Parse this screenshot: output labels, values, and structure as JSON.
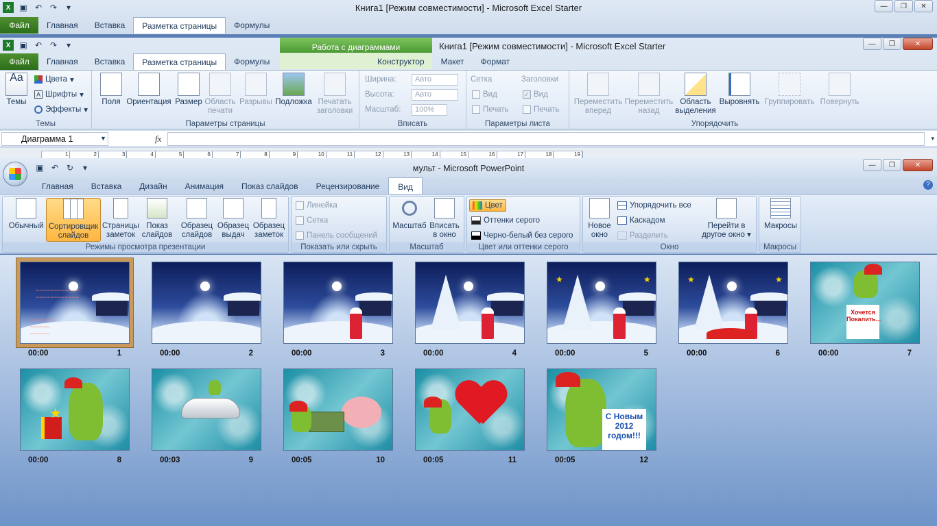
{
  "excel_bg": {
    "title": "Книга1  [Режим совместимости]  -  Microsoft Excel Starter",
    "tabs": [
      "Файл",
      "Главная",
      "Вставка",
      "Разметка страницы",
      "Формулы"
    ]
  },
  "excel": {
    "title": "Книга1  [Режим совместимости]  -  Microsoft Excel Starter",
    "chart_tools": "Работа с диаграммами",
    "tabs": [
      "Файл",
      "Главная",
      "Вставка",
      "Разметка страницы",
      "Формулы",
      "Конструктор",
      "Макет",
      "Формат"
    ],
    "ribbon": {
      "themes": {
        "label": "Темы",
        "btn": "Темы",
        "colors": "Цвета",
        "fonts": "Шрифты",
        "effects": "Эффекты"
      },
      "page_setup": {
        "label": "Параметры страницы",
        "margins": "Поля",
        "orientation": "Ориентация",
        "size": "Размер",
        "print_area_1": "Область",
        "print_area_2": "печати",
        "breaks": "Разрывы",
        "background": "Подложка",
        "print_titles_1": "Печатать",
        "print_titles_2": "заголовки"
      },
      "fit": {
        "label": "Вписать",
        "width": "Ширина:",
        "height": "Высота:",
        "scale": "Масштаб:",
        "width_val": "Авто",
        "height_val": "Авто",
        "scale_val": "100%"
      },
      "sheet": {
        "label": "Параметры листа",
        "grid": "Сетка",
        "headings": "Заголовки",
        "view": "Вид",
        "print": "Печать"
      },
      "arrange": {
        "label": "Упорядочить",
        "fwd_1": "Переместить",
        "fwd_2": "вперед",
        "back_1": "Переместить",
        "back_2": "назад",
        "sel_1": "Область",
        "sel_2": "выделения",
        "align": "Выровнять",
        "group": "Группировать",
        "rotate": "Повернуть"
      }
    },
    "name_box": "Диаграмма 1",
    "fx": "fx",
    "ruler_numbers": [
      "1",
      "2",
      "3",
      "4",
      "5",
      "6",
      "7",
      "8",
      "9",
      "10",
      "11",
      "12",
      "13",
      "14",
      "15",
      "16",
      "17",
      "18",
      "19"
    ]
  },
  "ppt": {
    "title": "мульт - Microsoft PowerPoint",
    "tabs": [
      "Главная",
      "Вставка",
      "Дизайн",
      "Анимация",
      "Показ слайдов",
      "Рецензирование",
      "Вид"
    ],
    "groups": {
      "views": {
        "label": "Режимы просмотра презентации",
        "normal": "Обычный",
        "sorter_1": "Сортировщик",
        "sorter_2": "слайдов",
        "notes_1": "Страницы",
        "notes_2": "заметок",
        "show_1": "Показ",
        "show_2": "слайдов",
        "master_slides_1": "Образец",
        "master_slides_2": "слайдов",
        "master_handouts_1": "Образец",
        "master_handouts_2": "выдач",
        "master_notes_1": "Образец",
        "master_notes_2": "заметок"
      },
      "showhide": {
        "label": "Показать или скрыть",
        "ruler": "Линейка",
        "grid": "Сетка",
        "messages": "Панель сообщений"
      },
      "zoom": {
        "label": "Масштаб",
        "zoom": "Масштаб",
        "fit_1": "Вписать",
        "fit_2": "в окно"
      },
      "color": {
        "label": "Цвет или оттенки серого",
        "color": "Цвет",
        "gray": "Оттенки серого",
        "bw": "Черно-белый без серого"
      },
      "window": {
        "label": "Окно",
        "new_1": "Новое",
        "new_2": "окно",
        "arrange_all": "Упорядочить все",
        "cascade": "Каскадом",
        "split": "Разделить",
        "switch_1": "Перейти в",
        "switch_2": "другое окно"
      },
      "macros": {
        "label": "Макросы",
        "macros": "Макросы"
      }
    },
    "slides": [
      {
        "time": "00:00",
        "num": "1",
        "theme": "night",
        "selected": true
      },
      {
        "time": "00:00",
        "num": "2",
        "theme": "night"
      },
      {
        "time": "00:00",
        "num": "3",
        "theme": "night"
      },
      {
        "time": "00:00",
        "num": "4",
        "theme": "night"
      },
      {
        "time": "00:00",
        "num": "5",
        "theme": "night"
      },
      {
        "time": "00:00",
        "num": "6",
        "theme": "night"
      },
      {
        "time": "00:00",
        "num": "7",
        "theme": "ice"
      },
      {
        "time": "00:00",
        "num": "8",
        "theme": "ice"
      },
      {
        "time": "00:03",
        "num": "9",
        "theme": "ice"
      },
      {
        "time": "00:05",
        "num": "10",
        "theme": "ice"
      },
      {
        "time": "00:05",
        "num": "11",
        "theme": "ice"
      },
      {
        "time": "00:05",
        "num": "12",
        "theme": "ice"
      }
    ],
    "slide7_sign": "Хочется Покалить...",
    "slide12_sign": "С Новым 2012 годом!!!"
  },
  "colors": {
    "file_tab": "#2b6e1a",
    "chart_tools": "#5fae43",
    "selected_view": "#ffb640",
    "sorter_bg": "#6d93c8"
  }
}
